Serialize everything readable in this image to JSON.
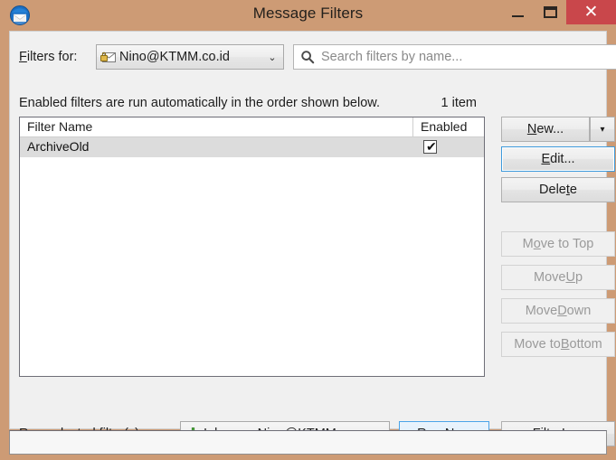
{
  "window": {
    "title": "Message Filters",
    "app_icon": "thunderbird-icon",
    "titlebar_color": "#cd9b75",
    "close_button_color": "#c9474b",
    "controls": {
      "minimize": "minimize-icon",
      "maximize": "maximize-icon",
      "close": "✕"
    }
  },
  "toolbar": {
    "filters_for_label_pre": "F",
    "filters_for_label_accel": "",
    "filters_for_label": "ilters for:",
    "account": {
      "value": "Nino@KTMM.co.id",
      "icon": "secure-mail-account-icon",
      "arrow": "⌄"
    },
    "search": {
      "placeholder": "Search filters by name...",
      "icon": "search-icon"
    }
  },
  "main": {
    "description": "Enabled filters are run automatically in the order shown below.",
    "item_count": "1 item",
    "list": {
      "columns": [
        "Filter Name",
        "Enabled"
      ],
      "rows": [
        {
          "name": "ArchiveOld",
          "enabled": true,
          "selected": true,
          "check_glyph": "✔"
        }
      ]
    }
  },
  "side_buttons": [
    {
      "label_pre": "",
      "label": "New...",
      "accel": "N",
      "enabled": true,
      "focused": false,
      "name": "new-button"
    },
    {
      "label": "⯆",
      "enabled": true,
      "name": "new-dropdown-button"
    },
    {
      "label": "Edit...",
      "accel": "E",
      "enabled": true,
      "focused": true,
      "name": "edit-button"
    },
    {
      "label": "Delete",
      "accel": "t",
      "enabled": true,
      "focused": false,
      "name": "delete-button"
    },
    {
      "label": "Move to Top",
      "accel": "o",
      "enabled": false,
      "name": "move-to-top-button"
    },
    {
      "label": "Move Up",
      "accel": "U",
      "enabled": false,
      "name": "move-up-button"
    },
    {
      "label": "Move Down",
      "accel": "D",
      "enabled": false,
      "name": "move-down-button"
    },
    {
      "label": "Move to Bottom",
      "accel": "B",
      "enabled": false,
      "name": "move-to-bottom-button"
    }
  ],
  "footer": {
    "run_on_label": "Run selected filter(s) on:",
    "folder": {
      "value": "Inbox on Nino@KTMM.c...",
      "icon": "inbox-icon",
      "arrow": "⌄"
    },
    "run_now_label": "Run Now",
    "run_now_accel": "R",
    "filter_log_label": "Filter Log",
    "filter_log_accel": "L"
  },
  "labels": {
    "new": "New...",
    "new_pre": "N",
    "new_post": "ew...",
    "edit_pre": "E",
    "edit_post": "dit...",
    "delete_pre": "Dele",
    "delete_mid": "t",
    "delete_post": "e",
    "move_top_pre": "M",
    "move_top_mid": "o",
    "move_top_post": "ve to Top",
    "move_up_pre": "Move ",
    "move_up_mid": "U",
    "move_up_post": "p",
    "move_down_pre": "Move ",
    "move_down_mid": "D",
    "move_down_post": "own",
    "move_bottom_pre": "Move to ",
    "move_bottom_mid": "B",
    "move_bottom_post": "ottom",
    "run_pre": "R",
    "run_post": "un Now",
    "log_pre": "Filter ",
    "log_mid": "L",
    "log_post": "og",
    "runon_pre": "Run sele",
    "runon_mid": "c",
    "runon_post": "ted filter(s) on:",
    "filtersfor_pre": "F",
    "filtersfor_post": "ilters for:",
    "new_arrow": "▾"
  },
  "colors": {
    "titlebar": "#cd9b75",
    "close": "#c9474b",
    "dialog_bg": "#f0f0f0",
    "list_bg": "#ffffff",
    "selection": "#dcdcdc",
    "focus_border": "#3f9bdc",
    "default_btn_bg": "#dbecfa"
  }
}
